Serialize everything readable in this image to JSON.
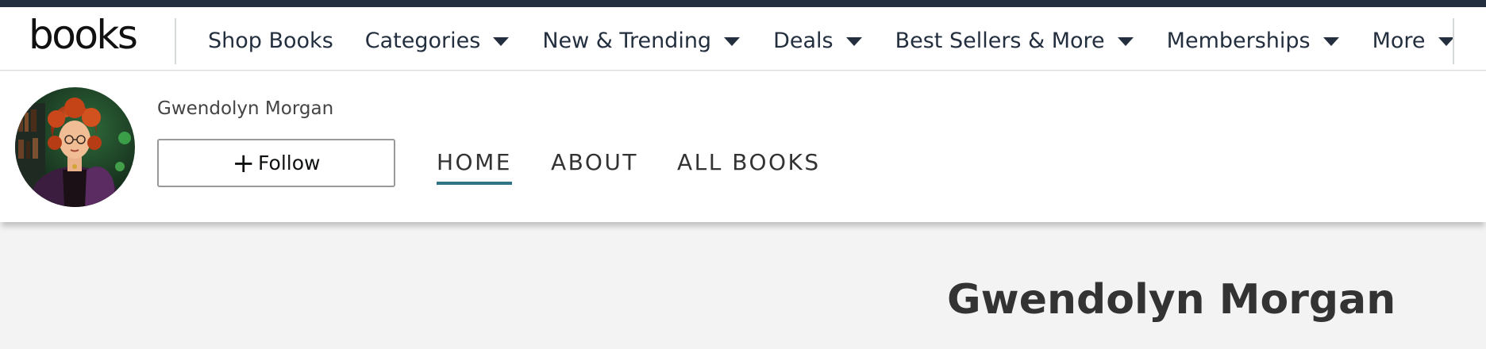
{
  "logo": {
    "text": "books"
  },
  "nav": {
    "items": [
      {
        "label": "Shop Books",
        "has_dropdown": false
      },
      {
        "label": "Categories",
        "has_dropdown": true
      },
      {
        "label": "New & Trending",
        "has_dropdown": true
      },
      {
        "label": "Deals",
        "has_dropdown": true
      },
      {
        "label": "Best Sellers & More",
        "has_dropdown": true
      },
      {
        "label": "Memberships",
        "has_dropdown": true
      },
      {
        "label": "More",
        "has_dropdown": true
      }
    ]
  },
  "author": {
    "name": "Gwendolyn Morgan",
    "follow_label": "Follow",
    "follow_icon": "plus-icon",
    "avatar_icon": "author-avatar-illustration"
  },
  "tabs": [
    {
      "label": "HOME",
      "active": true
    },
    {
      "label": "ABOUT",
      "active": false
    },
    {
      "label": "ALL BOOKS",
      "active": false
    }
  ],
  "main": {
    "heading": "Gwendolyn Morgan"
  },
  "colors": {
    "topbar": "#232f3e",
    "active_tab_underline": "#2f7486",
    "page_background": "#f3f3f3"
  }
}
